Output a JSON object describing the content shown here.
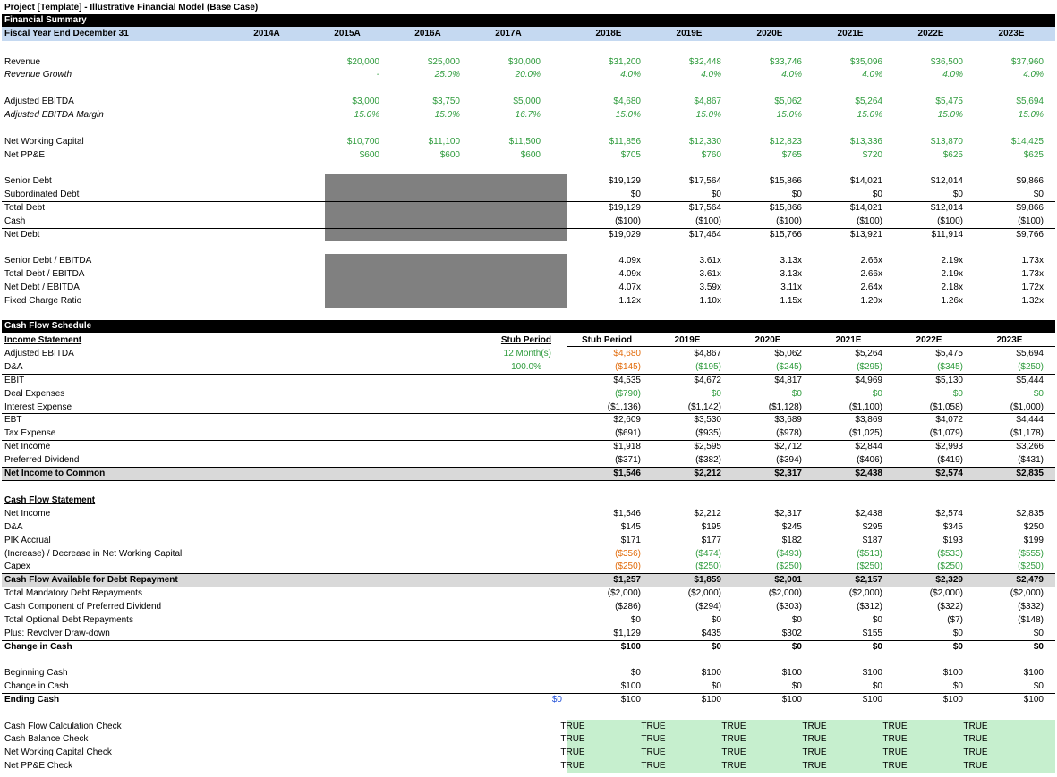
{
  "title": "Project [Template] - Illustrative Financial Model (Base Case)",
  "financial_summary": {
    "section_label": "Financial Summary",
    "header_label": "Fiscal Year End December 31",
    "years": [
      "2014A",
      "2015A",
      "2016A",
      "2017A",
      "2018E",
      "2019E",
      "2020E",
      "2021E",
      "2022E",
      "2023E"
    ],
    "rows": {
      "revenue": {
        "label": "Revenue",
        "values": [
          "",
          "$20,000",
          "$25,000",
          "$30,000",
          "$31,200",
          "$32,448",
          "$33,746",
          "$35,096",
          "$36,500",
          "$37,960"
        ]
      },
      "revenue_growth": {
        "label": "Revenue Growth",
        "values": [
          "",
          "-",
          "25.0%",
          "20.0%",
          "4.0%",
          "4.0%",
          "4.0%",
          "4.0%",
          "4.0%",
          "4.0%"
        ]
      },
      "adj_ebitda": {
        "label": "Adjusted EBITDA",
        "values": [
          "",
          "$3,000",
          "$3,750",
          "$5,000",
          "$4,680",
          "$4,867",
          "$5,062",
          "$5,264",
          "$5,475",
          "$5,694"
        ]
      },
      "adj_ebitda_margin": {
        "label": "Adjusted EBITDA Margin",
        "values": [
          "",
          "15.0%",
          "15.0%",
          "16.7%",
          "15.0%",
          "15.0%",
          "15.0%",
          "15.0%",
          "15.0%",
          "15.0%"
        ]
      },
      "nwc": {
        "label": "Net Working Capital",
        "values": [
          "",
          "$10,700",
          "$11,100",
          "$11,500",
          "$11,856",
          "$12,330",
          "$12,823",
          "$13,336",
          "$13,870",
          "$14,425"
        ]
      },
      "net_ppe": {
        "label": "Net PP&E",
        "values": [
          "",
          "$600",
          "$600",
          "$600",
          "$705",
          "$760",
          "$765",
          "$720",
          "$625",
          "$625"
        ]
      },
      "senior_debt": {
        "label": "Senior Debt",
        "values": [
          "$19,129",
          "$17,564",
          "$15,866",
          "$14,021",
          "$12,014",
          "$9,866"
        ]
      },
      "sub_debt": {
        "label": "Subordinated Debt",
        "values": [
          "$0",
          "$0",
          "$0",
          "$0",
          "$0",
          "$0"
        ]
      },
      "total_debt": {
        "label": "Total Debt",
        "values": [
          "$19,129",
          "$17,564",
          "$15,866",
          "$14,021",
          "$12,014",
          "$9,866"
        ]
      },
      "cash": {
        "label": "Cash",
        "values": [
          "($100)",
          "($100)",
          "($100)",
          "($100)",
          "($100)",
          "($100)"
        ]
      },
      "net_debt": {
        "label": "Net Debt",
        "values": [
          "$19,029",
          "$17,464",
          "$15,766",
          "$13,921",
          "$11,914",
          "$9,766"
        ]
      },
      "senior_debt_ebitda": {
        "label": "Senior Debt / EBITDA",
        "values": [
          "4.09x",
          "3.61x",
          "3.13x",
          "2.66x",
          "2.19x",
          "1.73x"
        ]
      },
      "total_debt_ebitda": {
        "label": "Total Debt / EBITDA",
        "values": [
          "4.09x",
          "3.61x",
          "3.13x",
          "2.66x",
          "2.19x",
          "1.73x"
        ]
      },
      "net_debt_ebitda": {
        "label": "Net Debt / EBITDA",
        "values": [
          "4.07x",
          "3.59x",
          "3.11x",
          "2.64x",
          "2.18x",
          "1.72x"
        ]
      },
      "fixed_charge": {
        "label": "Fixed Charge Ratio",
        "values": [
          "1.12x",
          "1.10x",
          "1.15x",
          "1.20x",
          "1.26x",
          "1.32x"
        ]
      }
    }
  },
  "cash_flow": {
    "section_label": "Cash Flow Schedule",
    "income_statement_label": "Income Statement",
    "stub_header": "Stub Period",
    "stub_months": "12 Month(s)",
    "stub_pct": "100.0%",
    "years": [
      "Stub Period",
      "2019E",
      "2020E",
      "2021E",
      "2022E",
      "2023E"
    ],
    "income_rows": [
      {
        "label": "Adjusted EBITDA",
        "values": [
          "$4,680",
          "$4,867",
          "$5,062",
          "$5,264",
          "$5,475",
          "$5,694"
        ]
      },
      {
        "label": "D&A",
        "values": [
          "($145)",
          "($195)",
          "($245)",
          "($295)",
          "($345)",
          "($250)"
        ]
      },
      {
        "label": "EBIT",
        "values": [
          "$4,535",
          "$4,672",
          "$4,817",
          "$4,969",
          "$5,130",
          "$5,444"
        ]
      },
      {
        "label": "Deal Expenses",
        "values": [
          "($790)",
          "$0",
          "$0",
          "$0",
          "$0",
          "$0"
        ]
      },
      {
        "label": "Interest Expense",
        "values": [
          "($1,136)",
          "($1,142)",
          "($1,128)",
          "($1,100)",
          "($1,058)",
          "($1,000)"
        ]
      },
      {
        "label": "EBT",
        "values": [
          "$2,609",
          "$3,530",
          "$3,689",
          "$3,869",
          "$4,072",
          "$4,444"
        ]
      },
      {
        "label": "Tax Expense",
        "values": [
          "($691)",
          "($935)",
          "($978)",
          "($1,025)",
          "($1,079)",
          "($1,178)"
        ]
      },
      {
        "label": "Net Income",
        "values": [
          "$1,918",
          "$2,595",
          "$2,712",
          "$2,844",
          "$2,993",
          "$3,266"
        ]
      },
      {
        "label": "Preferred Dividend",
        "values": [
          "($371)",
          "($382)",
          "($394)",
          "($406)",
          "($419)",
          "($431)"
        ]
      },
      {
        "label": "Net Income to Common",
        "values": [
          "$1,546",
          "$2,212",
          "$2,317",
          "$2,438",
          "$2,574",
          "$2,835"
        ]
      }
    ],
    "cash_flow_statement_label": "Cash Flow Statement",
    "cfs_rows": [
      {
        "label": "Net Income",
        "values": [
          "$1,546",
          "$2,212",
          "$2,317",
          "$2,438",
          "$2,574",
          "$2,835"
        ]
      },
      {
        "label": "D&A",
        "values": [
          "$145",
          "$195",
          "$245",
          "$295",
          "$345",
          "$250"
        ]
      },
      {
        "label": "PIK Accrual",
        "values": [
          "$171",
          "$177",
          "$182",
          "$187",
          "$193",
          "$199"
        ]
      },
      {
        "label": "(Increase) / Decrease in Net Working Capital",
        "values": [
          "($356)",
          "($474)",
          "($493)",
          "($513)",
          "($533)",
          "($555)"
        ]
      },
      {
        "label": "Capex",
        "values": [
          "($250)",
          "($250)",
          "($250)",
          "($250)",
          "($250)",
          "($250)"
        ]
      },
      {
        "label": "Cash Flow Available for Debt Repayment",
        "values": [
          "$1,257",
          "$1,859",
          "$2,001",
          "$2,157",
          "$2,329",
          "$2,479"
        ]
      },
      {
        "label": "Total Mandatory Debt Repayments",
        "values": [
          "($2,000)",
          "($2,000)",
          "($2,000)",
          "($2,000)",
          "($2,000)",
          "($2,000)"
        ]
      },
      {
        "label": "Cash Component of Preferred Dividend",
        "values": [
          "($286)",
          "($294)",
          "($303)",
          "($312)",
          "($322)",
          "($332)"
        ]
      },
      {
        "label": "Total Optional Debt Repayments",
        "values": [
          "$0",
          "$0",
          "$0",
          "$0",
          "($7)",
          "($148)"
        ]
      },
      {
        "label": "Plus: Revolver Draw-down",
        "values": [
          "$1,129",
          "$435",
          "$302",
          "$155",
          "$0",
          "$0"
        ]
      },
      {
        "label": "Change in Cash",
        "values": [
          "$100",
          "$0",
          "$0",
          "$0",
          "$0",
          "$0"
        ]
      }
    ],
    "cash_rows": [
      {
        "label": "Beginning Cash",
        "values": [
          "$0",
          "$100",
          "$100",
          "$100",
          "$100",
          "$100"
        ]
      },
      {
        "label": "Change in Cash",
        "values": [
          "$100",
          "$0",
          "$0",
          "$0",
          "$0",
          "$0"
        ]
      },
      {
        "label": "Ending Cash",
        "values": [
          "$100",
          "$100",
          "$100",
          "$100",
          "$100",
          "$100"
        ]
      }
    ],
    "ending_cash_stub": "$0",
    "check_rows": [
      {
        "label": "Cash Flow Calculation Check",
        "values": [
          "TRUE",
          "TRUE",
          "TRUE",
          "TRUE",
          "TRUE",
          "TRUE"
        ]
      },
      {
        "label": "Cash Balance Check",
        "values": [
          "TRUE",
          "TRUE",
          "TRUE",
          "TRUE",
          "TRUE",
          "TRUE"
        ]
      },
      {
        "label": "Net Working Capital Check",
        "values": [
          "TRUE",
          "TRUE",
          "TRUE",
          "TRUE",
          "TRUE",
          "TRUE"
        ]
      },
      {
        "label": "Net PP&E Check",
        "values": [
          "TRUE",
          "TRUE",
          "TRUE",
          "TRUE",
          "TRUE",
          "TRUE"
        ]
      }
    ]
  },
  "colors": {
    "input_green": "#2e9b3c",
    "input_orange": "#e26b0a",
    "header_blue": "#c5d9f1",
    "check_green": "#c6efce",
    "shade_gray": "#d9d9d9",
    "block_gray": "#808080"
  }
}
